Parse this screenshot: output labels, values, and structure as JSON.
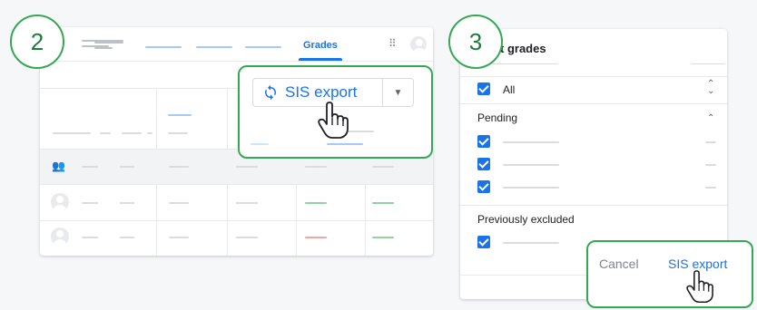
{
  "left_panel": {
    "tab_label": "Grades",
    "split_button": {
      "label": "SIS export",
      "icon": "sync-icon",
      "dropdown_icon": "caret-down-icon"
    },
    "step_badge": "2"
  },
  "right_panel": {
    "title_visible": "t grades",
    "step_badge": "3",
    "all_label": "All",
    "pending_label": "Pending",
    "excluded_label": "Previously excluded",
    "cancel_label": "Cancel",
    "export_label": "SIS export"
  },
  "colors": {
    "accent": "#1a73e8",
    "callout_green": "#34a853",
    "badge_text": "#188038"
  }
}
